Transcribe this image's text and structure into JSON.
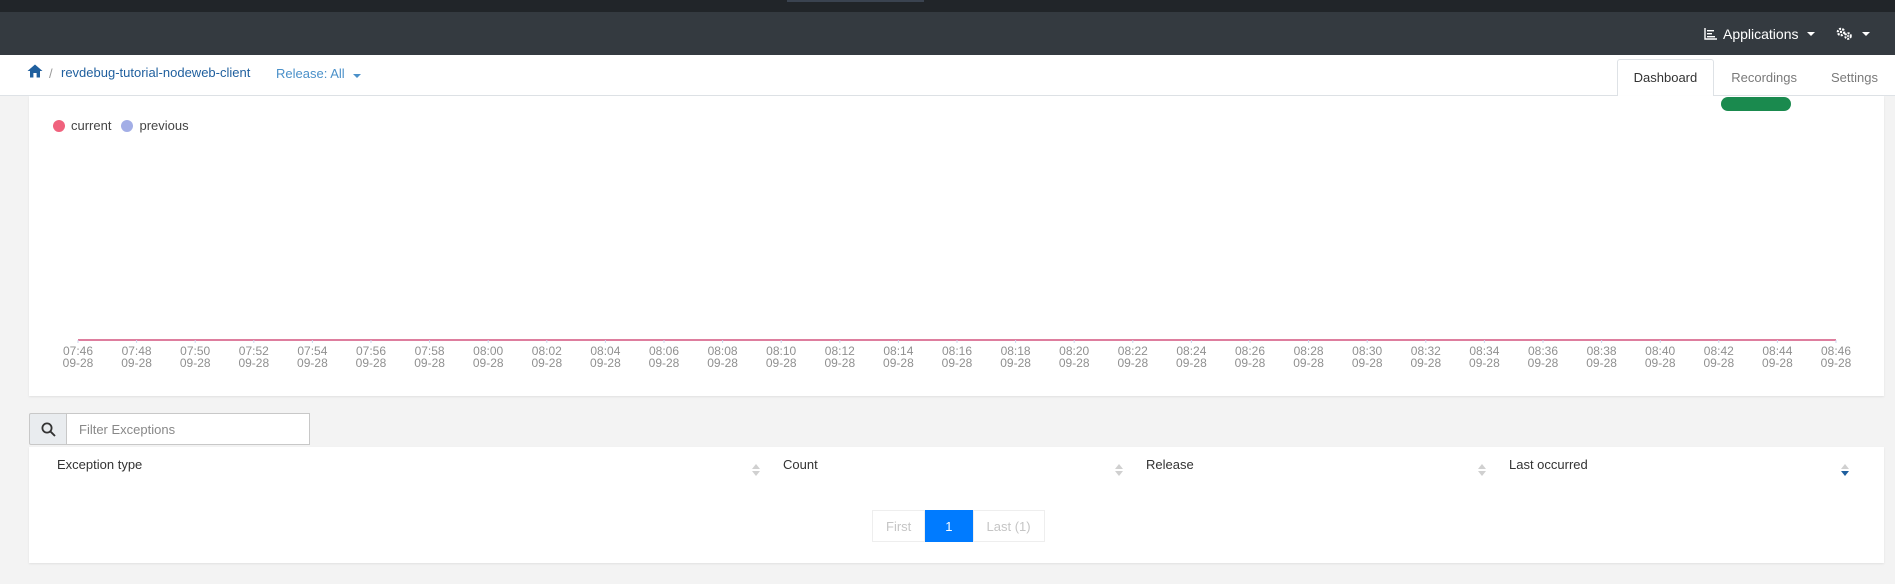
{
  "navbar": {
    "applications_label": "Applications"
  },
  "breadcrumb": {
    "separator": "/",
    "project": "revdebug-tutorial-nodeweb-client",
    "release": "Release: All"
  },
  "tabs": [
    {
      "label": "Dashboard",
      "active": true
    },
    {
      "label": "Recordings",
      "active": false
    },
    {
      "label": "Settings",
      "active": false
    }
  ],
  "chart_data": {
    "type": "line",
    "series": [
      {
        "name": "current",
        "color": "#f0627d",
        "values": [
          0,
          0,
          0,
          0,
          0,
          0,
          0,
          0,
          0,
          0,
          0,
          0,
          0,
          0,
          0,
          0,
          0,
          0,
          0,
          0,
          0,
          0,
          0,
          0,
          0,
          0,
          0,
          0,
          0,
          0,
          0
        ]
      },
      {
        "name": "previous",
        "color": "#a3aee6",
        "values": [
          0,
          0,
          0,
          0,
          0,
          0,
          0,
          0,
          0,
          0,
          0,
          0,
          0,
          0,
          0,
          0,
          0,
          0,
          0,
          0,
          0,
          0,
          0,
          0,
          0,
          0,
          0,
          0,
          0,
          0,
          0
        ]
      }
    ],
    "x": [
      [
        "07:46",
        "09-28"
      ],
      [
        "07:48",
        "09-28"
      ],
      [
        "07:50",
        "09-28"
      ],
      [
        "07:52",
        "09-28"
      ],
      [
        "07:54",
        "09-28"
      ],
      [
        "07:56",
        "09-28"
      ],
      [
        "07:58",
        "09-28"
      ],
      [
        "08:00",
        "09-28"
      ],
      [
        "08:02",
        "09-28"
      ],
      [
        "08:04",
        "09-28"
      ],
      [
        "08:06",
        "09-28"
      ],
      [
        "08:08",
        "09-28"
      ],
      [
        "08:10",
        "09-28"
      ],
      [
        "08:12",
        "09-28"
      ],
      [
        "08:14",
        "09-28"
      ],
      [
        "08:16",
        "09-28"
      ],
      [
        "08:18",
        "09-28"
      ],
      [
        "08:20",
        "09-28"
      ],
      [
        "08:22",
        "09-28"
      ],
      [
        "08:24",
        "09-28"
      ],
      [
        "08:26",
        "09-28"
      ],
      [
        "08:28",
        "09-28"
      ],
      [
        "08:30",
        "09-28"
      ],
      [
        "08:32",
        "09-28"
      ],
      [
        "08:34",
        "09-28"
      ],
      [
        "08:36",
        "09-28"
      ],
      [
        "08:38",
        "09-28"
      ],
      [
        "08:40",
        "09-28"
      ],
      [
        "08:42",
        "09-28"
      ],
      [
        "08:44",
        "09-28"
      ],
      [
        "08:46",
        "09-28"
      ]
    ],
    "legend_position": "top-left",
    "grid": false
  },
  "filter": {
    "placeholder": "Filter Exceptions"
  },
  "table": {
    "columns": [
      "Exception type",
      "Count",
      "Release",
      "Last occurred"
    ]
  },
  "pagination": {
    "first": "First",
    "current": "1",
    "last": "Last (1)"
  },
  "colors": {
    "navbar": "#343a40",
    "link": "#1f5f9e",
    "active_page": "#007bff",
    "status_bar": "#1a8a4e"
  }
}
